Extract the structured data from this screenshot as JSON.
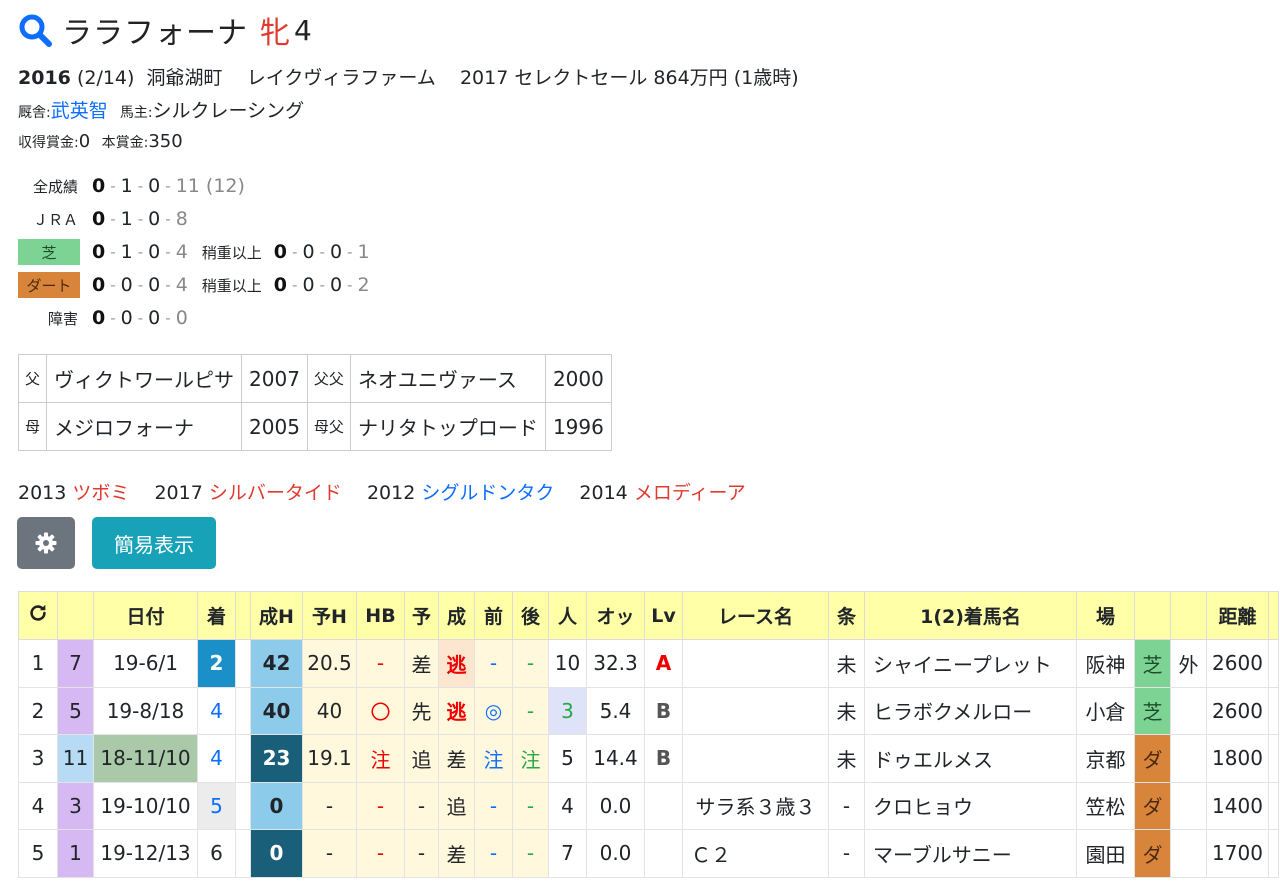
{
  "horse": {
    "name": "ララフォーナ",
    "sex": "牝",
    "age": "4",
    "birth_year": "2016",
    "birth_date": "(2/14)",
    "birthplace": "洞爺湖町",
    "breeder": "レイクヴィラファーム",
    "sale": "2017 セレクトセール 864万円 (1歳時)",
    "trainer_label": "厩舎:",
    "trainer": "武英智",
    "owner_label": "馬主:",
    "owner": "シルクレーシング",
    "prize_earned_label": "収得賞金:",
    "prize_earned": "0",
    "prize_main_label": "本賞金:",
    "prize_main": "350"
  },
  "records": {
    "all": {
      "label": "全成績",
      "w": "0",
      "p2": "1",
      "p3": "0",
      "rest": "11 (12)"
    },
    "jra": {
      "label": "ＪＲＡ",
      "w": "0",
      "p2": "1",
      "p3": "0",
      "rest": "8"
    },
    "turf": {
      "label": "芝",
      "w": "0",
      "p2": "1",
      "p3": "0",
      "rest": "4",
      "heavy_label": "稍重以上",
      "hw": "0",
      "hp2": "0",
      "hp3": "0",
      "hrest": "1"
    },
    "dirt": {
      "label": "ダート",
      "w": "0",
      "p2": "0",
      "p3": "0",
      "rest": "4",
      "heavy_label": "稍重以上",
      "hw": "0",
      "hp2": "0",
      "hp3": "0",
      "hrest": "2"
    },
    "jump": {
      "label": "障害",
      "w": "0",
      "p2": "0",
      "p3": "0",
      "rest": "0"
    }
  },
  "pedigree": {
    "sire_label": "父",
    "sire": "ヴィクトワールピサ",
    "sire_year": "2007",
    "sire_sire_label": "父父",
    "sire_sire": "ネオユニヴァース",
    "sire_sire_year": "2000",
    "dam_label": "母",
    "dam": "メジロフォーナ",
    "dam_year": "2005",
    "dam_sire_label": "母父",
    "dam_sire": "ナリタトップロード",
    "dam_sire_year": "1996"
  },
  "siblings": [
    {
      "year": "2013",
      "name": "ツボミ",
      "color": "red"
    },
    {
      "year": "2017",
      "name": "シルバータイド",
      "color": "red"
    },
    {
      "year": "2012",
      "name": "シグルドンタク",
      "color": "blue"
    },
    {
      "year": "2014",
      "name": "メロディーア",
      "color": "red"
    }
  ],
  "buttons": {
    "settings_icon": "gear-icon",
    "simple_view": "簡易表示"
  },
  "race_table": {
    "headers": {
      "refresh_icon": "refresh-icon",
      "date": "日付",
      "finish": "着",
      "seiH": "成H",
      "yoH": "予H",
      "hb": "HB",
      "yo": "予",
      "sei": "成",
      "mae": "前",
      "ato": "後",
      "pop": "人",
      "odds": "オッ",
      "lv": "Lv",
      "race": "レース名",
      "cond": "条",
      "winner": "1(2)着馬名",
      "venue": "場",
      "dist": "距離"
    },
    "rows": [
      {
        "no": "1",
        "waku": "7",
        "date": "19-6/1",
        "finish": "2",
        "seiH": "42",
        "yoH": "20.5",
        "hb": "-",
        "yo": "差",
        "sei": "逃",
        "mae": "-",
        "ato": "-",
        "pop": "10",
        "odds": "32.3",
        "lv": "A",
        "race": "",
        "cond": "未",
        "winner": "シャイニープレット",
        "venue": "阪神",
        "surface": "芝",
        "course": "外",
        "dist": "2600"
      },
      {
        "no": "2",
        "waku": "5",
        "date": "19-8/18",
        "finish": "4",
        "seiH": "40",
        "yoH": "40",
        "hb": "〇",
        "yo": "先",
        "sei": "逃",
        "mae": "◎",
        "ato": "-",
        "pop": "3",
        "odds": "5.4",
        "lv": "B",
        "race": "",
        "cond": "未",
        "winner": "ヒラボクメルロー",
        "venue": "小倉",
        "surface": "芝",
        "course": "",
        "dist": "2600"
      },
      {
        "no": "3",
        "waku": "11",
        "date": "18-11/10",
        "finish": "4",
        "seiH": "23",
        "yoH": "19.1",
        "hb": "注",
        "yo": "追",
        "sei": "差",
        "mae": "注",
        "ato": "注",
        "pop": "5",
        "odds": "14.4",
        "lv": "B",
        "race": "",
        "cond": "未",
        "winner": "ドゥエルメス",
        "venue": "京都",
        "surface": "ダ",
        "course": "",
        "dist": "1800"
      },
      {
        "no": "4",
        "waku": "3",
        "date": "19-10/10",
        "finish": "5",
        "seiH": "0",
        "yoH": "-",
        "hb": "-",
        "yo": "-",
        "sei": "追",
        "mae": "-",
        "ato": "-",
        "pop": "4",
        "odds": "0.0",
        "lv": "",
        "race": "サラ系３歳３",
        "cond": "-",
        "winner": "クロヒョウ",
        "venue": "笠松",
        "surface": "ダ",
        "course": "",
        "dist": "1400"
      },
      {
        "no": "5",
        "waku": "1",
        "date": "19-12/13",
        "finish": "6",
        "seiH": "0",
        "yoH": "-",
        "hb": "-",
        "yo": "-",
        "sei": "差",
        "mae": "-",
        "ato": "-",
        "pop": "7",
        "odds": "0.0",
        "lv": "",
        "race": "Ｃ２",
        "cond": "-",
        "winner": "マーブルサニー",
        "venue": "園田",
        "surface": "ダ",
        "course": "",
        "dist": "1700"
      }
    ]
  },
  "colors": {
    "accent_blue": "#0d6efd",
    "sex_red": "#e03a2e",
    "header_yellow": "#ffffa8",
    "turf_green": "#7dd394",
    "dirt_orange": "#d9843b",
    "settings_gray": "#6c757d",
    "simple_teal": "#17a2b8"
  }
}
